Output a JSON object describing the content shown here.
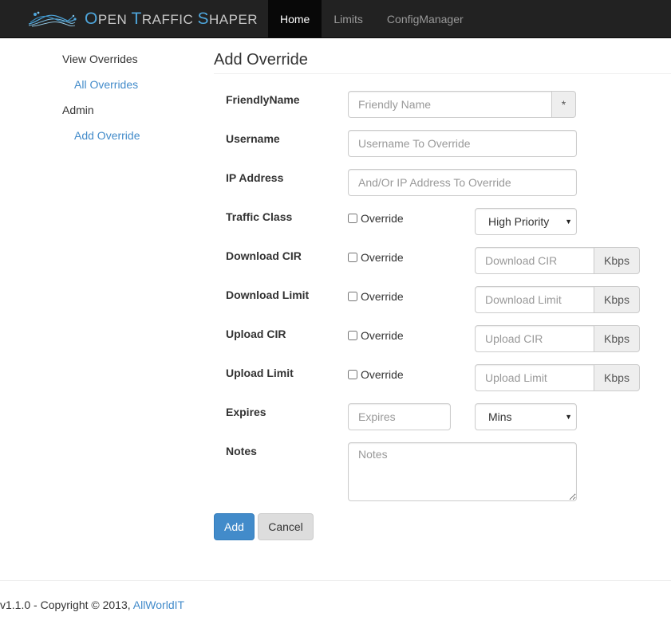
{
  "brand": {
    "logo": "network-fibers-logo",
    "title_parts": [
      {
        "text": "O",
        "big": true,
        "hl": true
      },
      {
        "text": "PEN ",
        "big": false,
        "hl": false
      },
      {
        "text": "T",
        "big": true,
        "hl": true
      },
      {
        "text": "RAFFIC ",
        "big": false,
        "hl": false
      },
      {
        "text": "S",
        "big": true,
        "hl": true
      },
      {
        "text": "HAPER",
        "big": false,
        "hl": false
      }
    ],
    "accent_color": "#4ea6dc"
  },
  "nav": {
    "items": [
      {
        "label": "Home",
        "active": true
      },
      {
        "label": "Limits",
        "active": false
      },
      {
        "label": "ConfigManager",
        "active": false
      }
    ]
  },
  "sidebar": {
    "sections": [
      {
        "heading": "View Overrides",
        "links": [
          "All Overrides"
        ]
      },
      {
        "heading": "Admin",
        "links": [
          "Add Override"
        ]
      }
    ]
  },
  "form": {
    "title": "Add Override",
    "friendly_name": {
      "label": "FriendlyName",
      "placeholder": "Friendly Name",
      "required_marker": "*"
    },
    "username": {
      "label": "Username",
      "placeholder": "Username To Override"
    },
    "ip_address": {
      "label": "IP Address",
      "placeholder": "And/Or IP Address To Override"
    },
    "traffic_class": {
      "label": "Traffic Class",
      "override_label": "Override",
      "selected": "High Priority"
    },
    "download_cir": {
      "label": "Download CIR",
      "override_label": "Override",
      "placeholder": "Download CIR",
      "unit": "Kbps"
    },
    "download_limit": {
      "label": "Download Limit",
      "override_label": "Override",
      "placeholder": "Download Limit",
      "unit": "Kbps"
    },
    "upload_cir": {
      "label": "Upload CIR",
      "override_label": "Override",
      "placeholder": "Upload CIR",
      "unit": "Kbps"
    },
    "upload_limit": {
      "label": "Upload Limit",
      "override_label": "Override",
      "placeholder": "Upload Limit",
      "unit": "Kbps"
    },
    "expires": {
      "label": "Expires",
      "placeholder": "Expires",
      "unit_selected": "Mins"
    },
    "notes": {
      "label": "Notes",
      "placeholder": "Notes"
    },
    "add_label": "Add",
    "cancel_label": "Cancel"
  },
  "footer": {
    "text": "v1.1.0 - Copyright © 2013, ",
    "link": "AllWorldIT"
  },
  "colors": {
    "navbar_bg": "#222222",
    "link": "#428bca",
    "primary_button": "#428bca"
  }
}
